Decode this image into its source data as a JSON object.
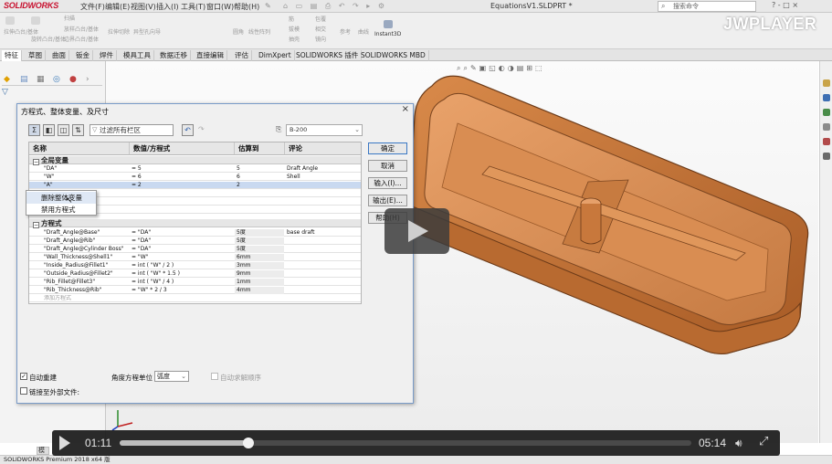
{
  "app": {
    "logo": "SOLIDWORKS",
    "menu": [
      "文件(F)",
      "编辑(E)",
      "视图(V)",
      "插入(I)",
      "工具(T)",
      "窗口(W)",
      "帮助(H)"
    ],
    "doc_title": "EquationsV1.SLDPRT *",
    "search_placeholder": "搜索命令",
    "window_controls": "? - □ ×"
  },
  "toolbar": {
    "groups": [
      "拉伸凸台/基体",
      "扫描",
      "旋转凸台/基体",
      "放样凸台/基体",
      "边界凸台/基体",
      "拉伸切除",
      "异型孔向导",
      "圆角",
      "线性阵列",
      "筋",
      "拔模",
      "抽壳",
      "包覆",
      "相交",
      "镜向",
      "参考",
      "曲线"
    ],
    "instant3d": "Instant3D"
  },
  "tabs": [
    "特征",
    "草图",
    "曲面",
    "钣金",
    "焊件",
    "模具工具",
    "数据迁移",
    "直接编辑",
    "评估",
    "DimXpert",
    "SOLIDWORKS 插件",
    "SOLIDWORKS MBD"
  ],
  "watermark": "JWPLAYER",
  "dialog": {
    "title": "方程式、整体变量、及尺寸",
    "close": "×",
    "filter_text": "过滤所有栏区",
    "configuration": "B-200",
    "buttons": {
      "ok": "确定",
      "cancel": "取消",
      "import": "输入(I)...",
      "export": "输出(E)...",
      "help": "帮助(H)"
    },
    "columns": [
      "名称",
      "数值/方程式",
      "估算到",
      "评论"
    ],
    "groups": {
      "global": "全局变量",
      "equations": "方程式"
    },
    "global_rows": [
      {
        "name": "\"DA\"",
        "value": "= 5",
        "eval": "5",
        "comment": "Draft Angle"
      },
      {
        "name": "\"W\"",
        "value": "= 6",
        "eval": "6",
        "comment": "Shell"
      },
      {
        "name": "\"A\"",
        "value": "= 2",
        "eval": "2",
        "comment": ""
      }
    ],
    "equation_rows": [
      {
        "name": "\"Draft_Angle@Base\"",
        "value": "= \"DA\"",
        "eval": "5度",
        "comment": "base draft"
      },
      {
        "name": "\"Draft_Angle@Rib\"",
        "value": "= \"DA\"",
        "eval": "5度",
        "comment": ""
      },
      {
        "name": "\"Draft_Angle@Cylinder Boss\"",
        "value": "= \"DA\"",
        "eval": "5度",
        "comment": ""
      },
      {
        "name": "\"Wall_Thickness@Shell1\"",
        "value": "= \"W\"",
        "eval": "6mm",
        "comment": ""
      },
      {
        "name": "\"Inside_Radius@Fillet1\"",
        "value": "= int ( \"W\" / 2 )",
        "eval": "3mm",
        "comment": ""
      },
      {
        "name": "\"Outside_Radius@Fillet2\"",
        "value": "= int ( \"W\" * 1.5 )",
        "eval": "9mm",
        "comment": ""
      },
      {
        "name": "\"Rib_Fillet@Fillet3\"",
        "value": "= int ( \"W\" / 4 )",
        "eval": "1mm",
        "comment": ""
      },
      {
        "name": "\"Rib_Thickness@Rib\"",
        "value": "= \"W\" * 2 / 3",
        "eval": "4mm",
        "comment": ""
      }
    ],
    "add_equation": "添加方程式",
    "context_menu": [
      "删除整体变量",
      "禁用方程式"
    ],
    "auto_rebuild": "自动重建",
    "angle_unit_label": "角度方程单位",
    "angle_unit_value": "弧度",
    "auto_solve_order": "自动求解顺序",
    "link_external": "链接至外部文件:"
  },
  "status_bar": "SOLIDWORKS Premium 2018 x64 版",
  "bottom_tab": "模",
  "player": {
    "current_time": "01:11",
    "duration": "05:14",
    "progress_fraction": 0.226
  },
  "colors": {
    "part_orange": "#c87a3e",
    "dialog_border": "#7a9cc9",
    "selection_row": "#c9d9f0",
    "player_bg": "#191919"
  }
}
